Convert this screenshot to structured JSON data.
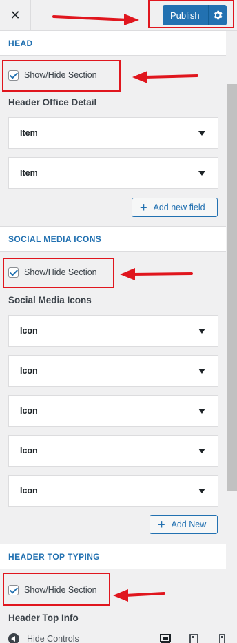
{
  "header": {
    "close_icon": "close-icon",
    "publish_label": "Publish",
    "publish_settings_icon": "gear-icon"
  },
  "sections": {
    "head": {
      "title": "HEAD",
      "toggle_label": "Show/Hide Section",
      "field_label": "Header Office Detail",
      "items": [
        "Item",
        "Item"
      ],
      "add_label": "Add new field"
    },
    "social": {
      "title": "SOCIAL MEDIA ICONS",
      "toggle_label": "Show/Hide Section",
      "field_label": "Social Media Icons",
      "items": [
        "Icon",
        "Icon",
        "Icon",
        "Icon",
        "Icon"
      ],
      "add_label": "Add New"
    },
    "typing": {
      "title": "HEADER TOP TYPING",
      "toggle_label": "Show/Hide Section",
      "field_label": "Header Top Info"
    }
  },
  "footer": {
    "hide_controls_label": "Hide Controls"
  },
  "colors": {
    "accent": "#2271b1",
    "highlight": "#e0161e",
    "background": "#f0f0f1"
  }
}
